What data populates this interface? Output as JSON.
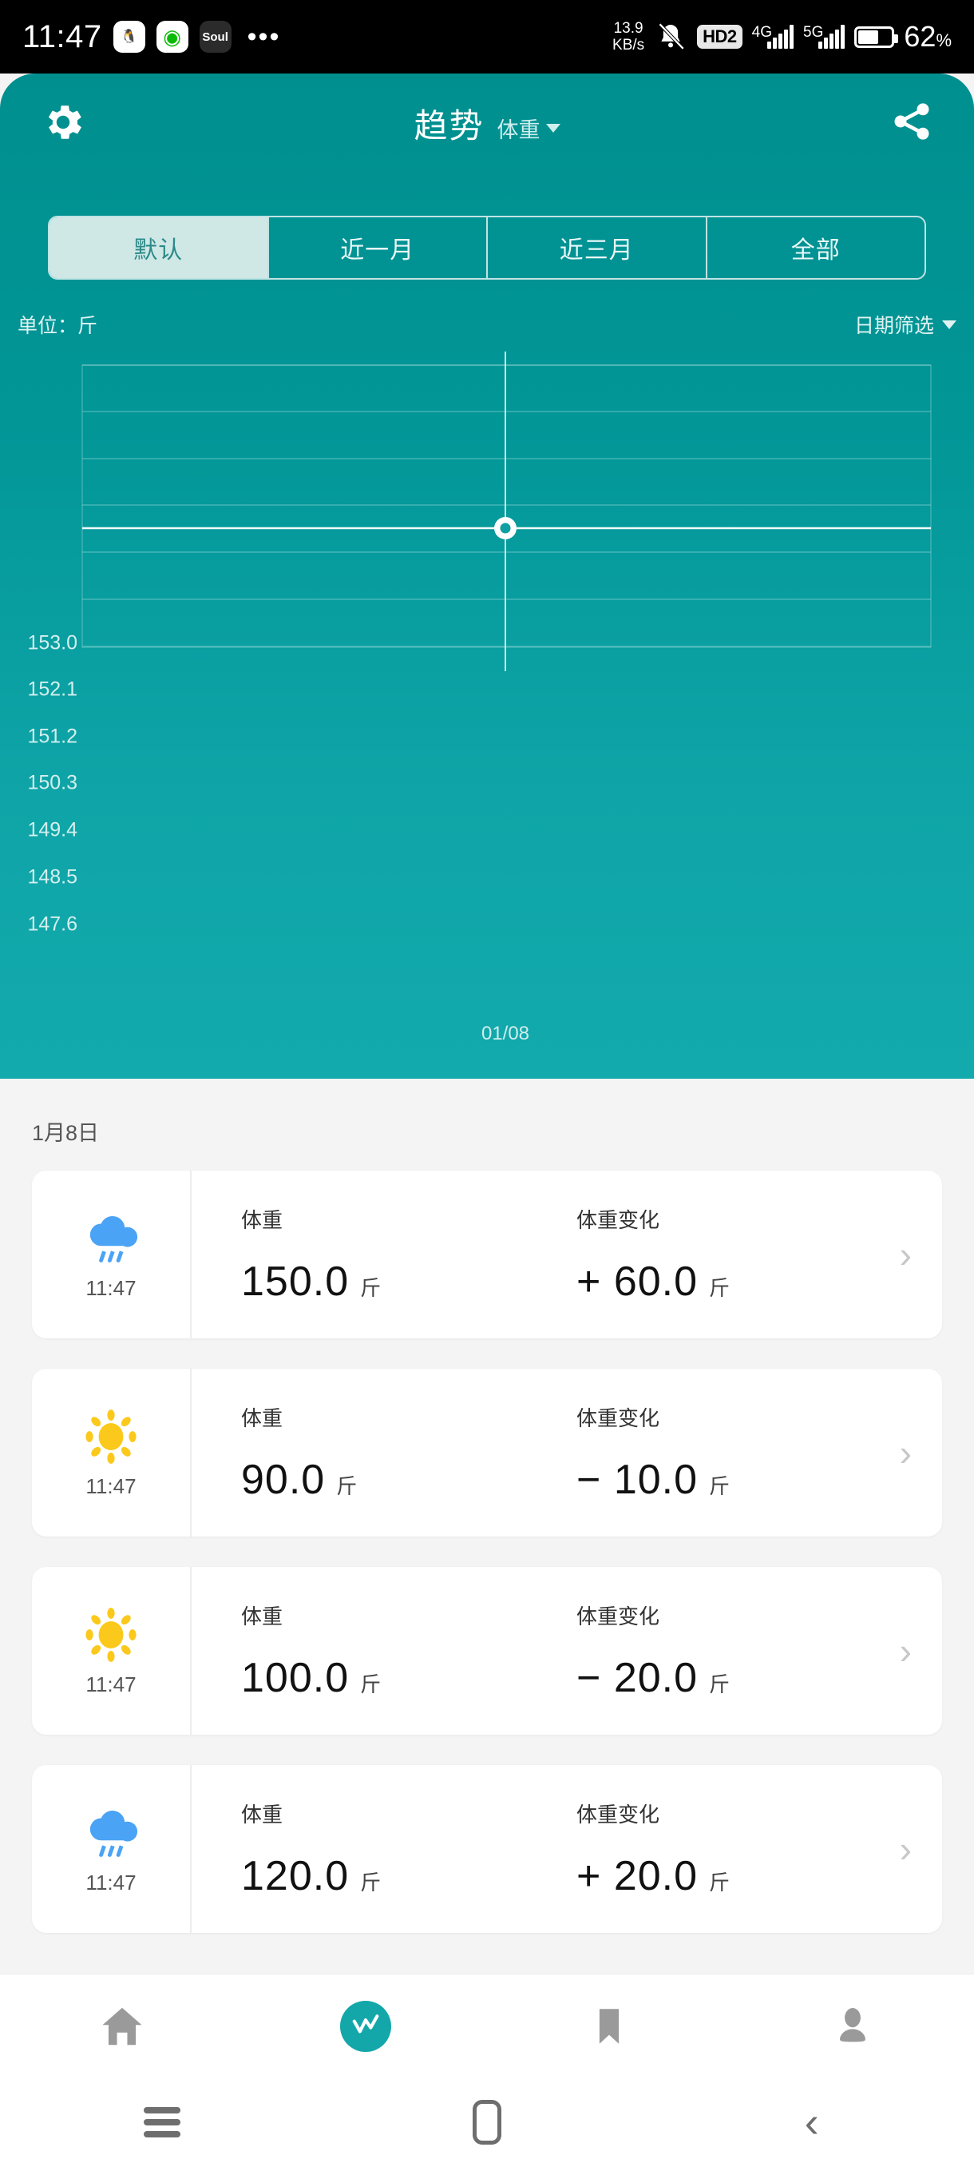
{
  "statusbar": {
    "clock": "11:47",
    "app_icons": [
      "qq-icon",
      "wechat-icon",
      "soul-icon"
    ],
    "overflow": "•••",
    "net_speed_value": "13.9",
    "net_speed_unit": "KB/s",
    "mute_icon": "bell-muted-icon",
    "hd_badge": "HD2",
    "sim1_label": "4G",
    "sim2_label": "5G",
    "battery_percent": "62",
    "battery_percent_symbol": "%"
  },
  "header": {
    "gear_icon": "gear-icon",
    "title": "趋势",
    "subtitle": "体重",
    "share_icon": "share-icon"
  },
  "tabs": [
    {
      "label": "默认",
      "active": true
    },
    {
      "label": "近一月",
      "active": false
    },
    {
      "label": "近三月",
      "active": false
    },
    {
      "label": "全部",
      "active": false
    }
  ],
  "chart_meta": {
    "unit_label": "单位：斤",
    "date_filter_label": "日期筛选"
  },
  "chart_data": {
    "type": "line",
    "title": "趋势",
    "xlabel": "",
    "ylabel": "斤",
    "unit": "斤",
    "x": [
      "01/08"
    ],
    "categories": [
      "01/08"
    ],
    "series": [
      {
        "name": "体重",
        "values": [
          150.0
        ]
      }
    ],
    "yticks": [
      "153.0",
      "152.1",
      "151.2",
      "150.3",
      "149.4",
      "148.5",
      "147.6"
    ],
    "ytick_values": [
      153.0,
      152.1,
      151.2,
      150.3,
      149.4,
      148.5,
      147.6
    ],
    "ylim": [
      147.6,
      153.0
    ],
    "grid": true,
    "legend": "none",
    "marker": "hollow-circle",
    "crosshair": true
  },
  "list": {
    "date_heading": "1月8日",
    "rows": [
      {
        "weather_icon": "rain-cloud-icon",
        "time": "11:47",
        "weight_label": "体重",
        "weight_value": "150.0",
        "weight_unit": "斤",
        "change_label": "体重变化",
        "change_value": "+ 60.0",
        "change_unit": "斤",
        "chevron": "chevron-right-icon"
      },
      {
        "weather_icon": "sun-icon",
        "time": "11:47",
        "weight_label": "体重",
        "weight_value": "90.0",
        "weight_unit": "斤",
        "change_label": "体重变化",
        "change_value": "− 10.0",
        "change_unit": "斤",
        "chevron": "chevron-right-icon"
      },
      {
        "weather_icon": "sun-icon",
        "time": "11:47",
        "weight_label": "体重",
        "weight_value": "100.0",
        "weight_unit": "斤",
        "change_label": "体重变化",
        "change_value": "− 20.0",
        "change_unit": "斤",
        "chevron": "chevron-right-icon"
      },
      {
        "weather_icon": "rain-cloud-icon",
        "time": "11:47",
        "weight_label": "体重",
        "weight_value": "120.0",
        "weight_unit": "斤",
        "change_label": "体重变化",
        "change_value": "+ 20.0",
        "change_unit": "斤",
        "chevron": "chevron-right-icon"
      }
    ]
  },
  "bottom_nav": [
    {
      "icon": "home-icon",
      "active": false
    },
    {
      "icon": "trend-icon",
      "active": true
    },
    {
      "icon": "bookmark-icon",
      "active": false
    },
    {
      "icon": "profile-icon",
      "active": false
    }
  ],
  "android_nav": [
    {
      "icon": "recents-menu-icon"
    },
    {
      "icon": "home-square-icon"
    },
    {
      "icon": "back-chevron-icon"
    }
  ],
  "colors": {
    "teal_top": "#008f8f",
    "teal_bottom": "#13aaad",
    "accent": "#13a7aa",
    "tab_active_bg": "#cfe8e6",
    "page_bg": "#f4f4f4",
    "sun": "#fbc91b",
    "rain": "#4aa3f5"
  }
}
